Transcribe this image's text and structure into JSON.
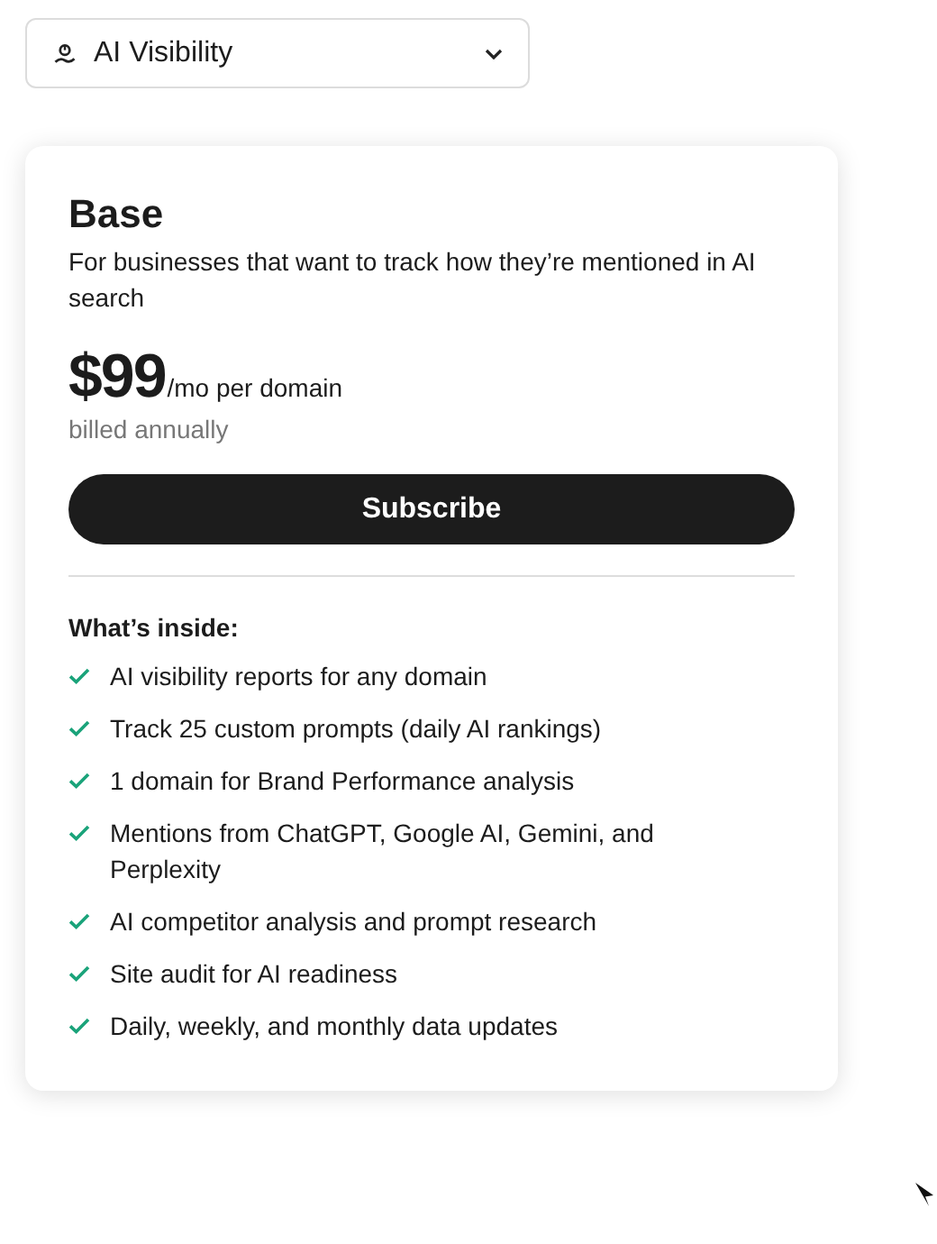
{
  "selector": {
    "value": "AI Visibility"
  },
  "plan": {
    "name": "Base",
    "description": "For businesses that want to track how they’re mentioned in AI search",
    "price": "$99",
    "price_unit": "/mo per domain",
    "billing": "billed annually",
    "button": "Subscribe",
    "features_heading": "What’s inside:",
    "features": [
      "AI visibility reports for any domain",
      "Track 25 custom prompts (daily AI rankings)",
      "1 domain for Brand Performance analysis",
      "Mentions from ChatGPT, Google AI, Gemini, and Perplexity",
      "AI competitor analysis and prompt research",
      "Site audit for AI readiness",
      "Daily, weekly, and monthly data updates"
    ]
  }
}
